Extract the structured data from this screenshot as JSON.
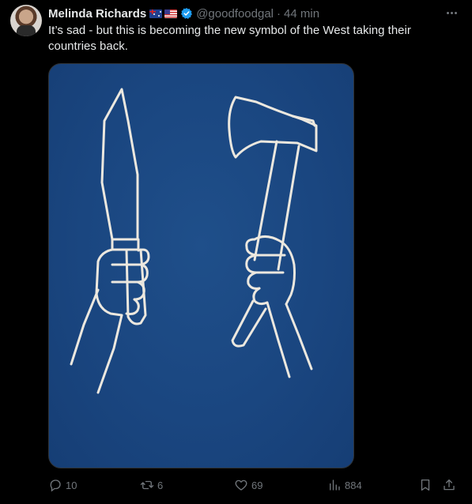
{
  "tweet": {
    "author_name": "Melinda Richards",
    "flags": [
      "australia-flag",
      "usa-flag"
    ],
    "handle": "@goodfoodgal",
    "separator": "·",
    "time": "44 min",
    "text": "It’s sad - but this is becoming the new symbol of the West taking their countries back.",
    "media_background_color": "#1a4680"
  },
  "actions": {
    "replies": "10",
    "reposts": "6",
    "likes": "69",
    "views": "884"
  },
  "colors": {
    "background": "#000000",
    "text": "#e7e9ea",
    "muted": "#71767b",
    "verified": "#1d9bf0"
  }
}
